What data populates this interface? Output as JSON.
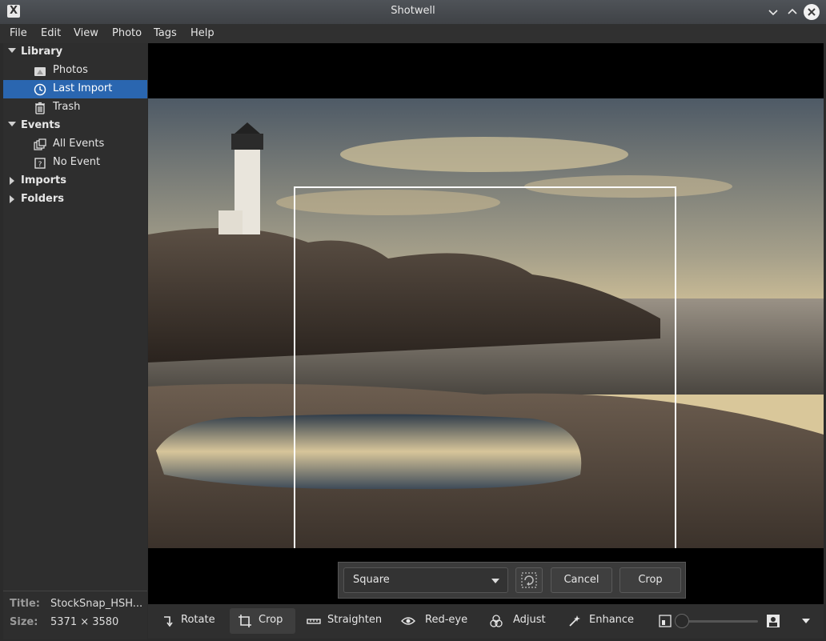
{
  "window": {
    "title": "Shotwell",
    "app_icon": "x-icon"
  },
  "menubar": {
    "items": [
      "File",
      "Edit",
      "View",
      "Photo",
      "Tags",
      "Help"
    ]
  },
  "sidebar": {
    "library": {
      "header": "Library",
      "items": [
        {
          "label": "Photos",
          "icon": "photos-icon"
        },
        {
          "label": "Last Import",
          "icon": "clock-icon",
          "selected": true
        },
        {
          "label": "Trash",
          "icon": "trash-icon"
        }
      ]
    },
    "events": {
      "header": "Events",
      "items": [
        {
          "label": "All Events",
          "icon": "all-events-icon"
        },
        {
          "label": "No Event",
          "icon": "no-event-icon"
        }
      ]
    },
    "imports": {
      "header": "Imports"
    },
    "folders": {
      "header": "Folders"
    }
  },
  "info": {
    "title_label": "Title:",
    "title_value": "StockSnap_HSH...",
    "size_label": "Size:",
    "size_value": "5371 × 3580"
  },
  "cropbar": {
    "constraint_value": "Square",
    "cancel_label": "Cancel",
    "crop_label": "Crop"
  },
  "toolbar": {
    "rotate": "Rotate",
    "crop": "Crop",
    "straighten": "Straighten",
    "redeye": "Red-eye",
    "adjust": "Adjust",
    "enhance": "Enhance"
  },
  "colors": {
    "selection": "#2a66b0",
    "background": "#2b2b2b"
  }
}
